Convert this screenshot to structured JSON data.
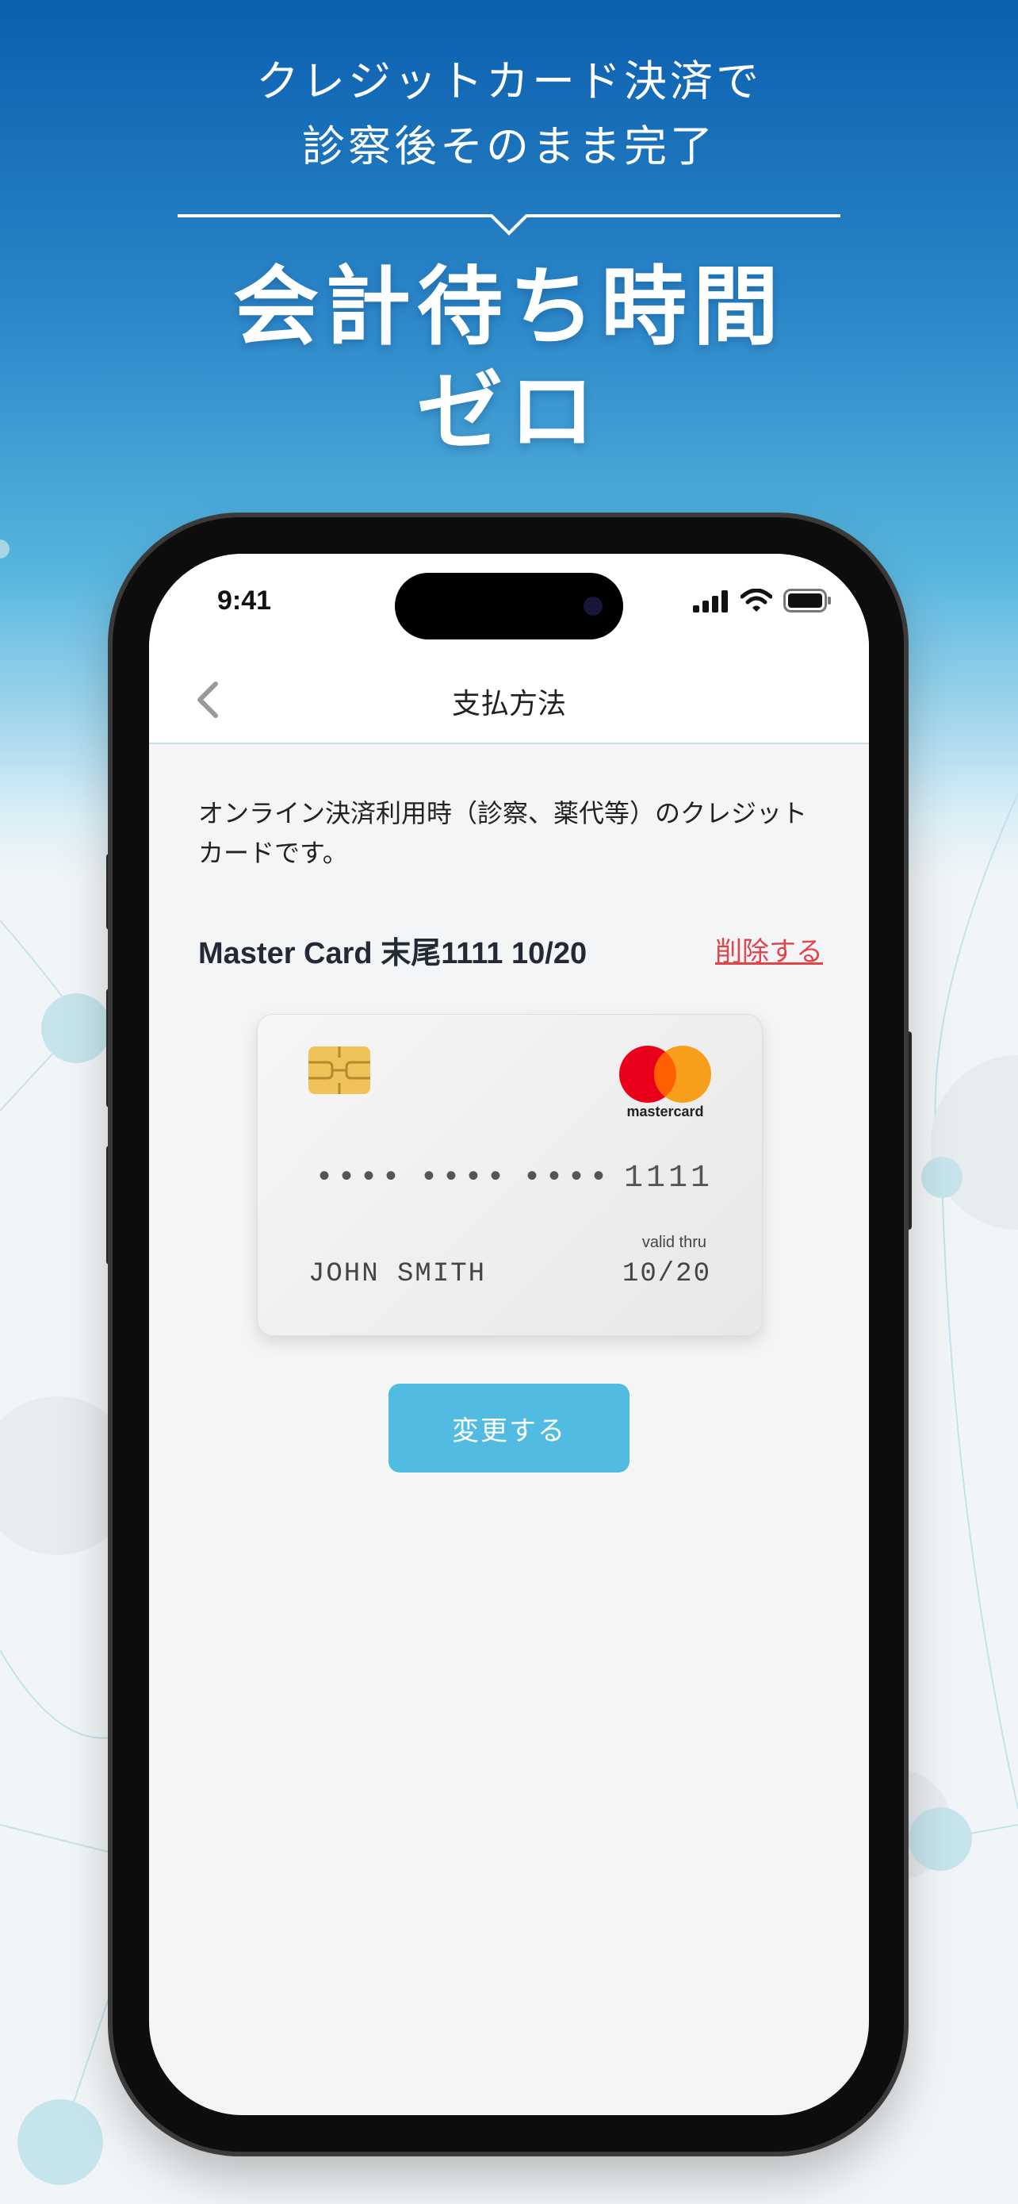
{
  "promo": {
    "subline1": "クレジットカード決済で",
    "subline2": "診察後そのまま完了",
    "headline1": "会計待ち時間",
    "headline2": "ゼロ"
  },
  "status_bar": {
    "time": "9:41",
    "icons": [
      "signal-icon",
      "wifi-icon",
      "battery-icon"
    ]
  },
  "nav": {
    "back_icon": "chevron-left-icon",
    "title": "支払方法"
  },
  "content": {
    "description": "オンライン決済利用時（診察、薬代等）のクレジットカードです。",
    "card_summary": "Master Card 末尾1111 10/20",
    "delete_label": "削除する"
  },
  "credit_card": {
    "brand": "mastercard",
    "group1": "••••",
    "group2": "••••",
    "group3": "••••",
    "last4": "1111",
    "valid_label": "valid thru",
    "holder": "JOHN SMITH",
    "expiry": "10/20"
  },
  "actions": {
    "change_label": "変更する"
  },
  "colors": {
    "accent": "#52bbe2",
    "danger": "#e0454b",
    "mc_red": "#eb001b",
    "mc_orange": "#f79e1b"
  }
}
